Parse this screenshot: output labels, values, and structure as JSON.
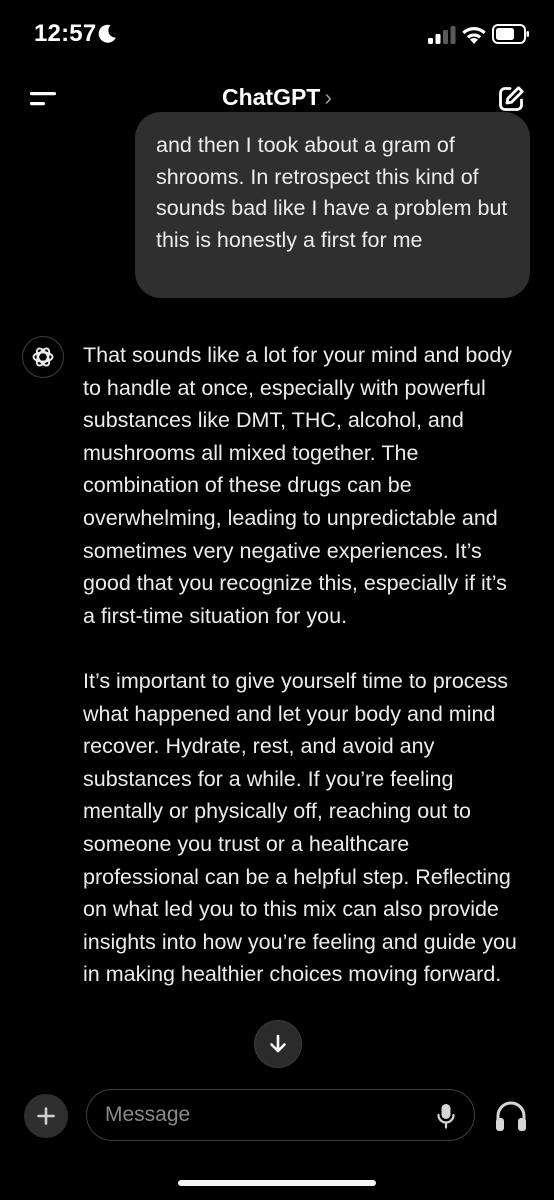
{
  "status_bar": {
    "time": "12:57",
    "icons": [
      "moon-icon",
      "cellular-signal-icon",
      "wifi-icon",
      "battery-icon"
    ]
  },
  "header": {
    "title": "ChatGPT",
    "chevron": "›",
    "left_icon": "menu-icon",
    "right_icon": "new-chat-icon"
  },
  "conversation": {
    "user_message": "and then I took about a gram of shrooms. In retrospect this kind of sounds bad like I have a problem but this is honestly a first for me",
    "assistant_paragraphs": [
      "That sounds like a lot for your mind and body to handle at once, especially with powerful substances like DMT, THC, alcohol, and mushrooms all mixed together. The combination of these drugs can be overwhelming, leading to unpredictable and sometimes very negative experiences. It’s good that you recognize this, especially if it’s a first-time situation for you.",
      "It’s important to give yourself time to process what happened and let your body and mind recover. Hydrate, rest, and avoid any substances for a while. If you’re feeling mentally or physically off, reaching out to someone you trust or a healthcare professional can be a helpful step. Reflecting on what led you to this mix can also provide insights into how you’re feeling and guide you in making healthier choices moving forward."
    ]
  },
  "composer": {
    "placeholder": "Message",
    "value": "",
    "icons": [
      "plus-icon",
      "microphone-icon",
      "headphones-icon",
      "arrow-down-icon"
    ]
  },
  "colors": {
    "background": "#000000",
    "bubble": "#2f2f2f",
    "text": "#ececec"
  }
}
